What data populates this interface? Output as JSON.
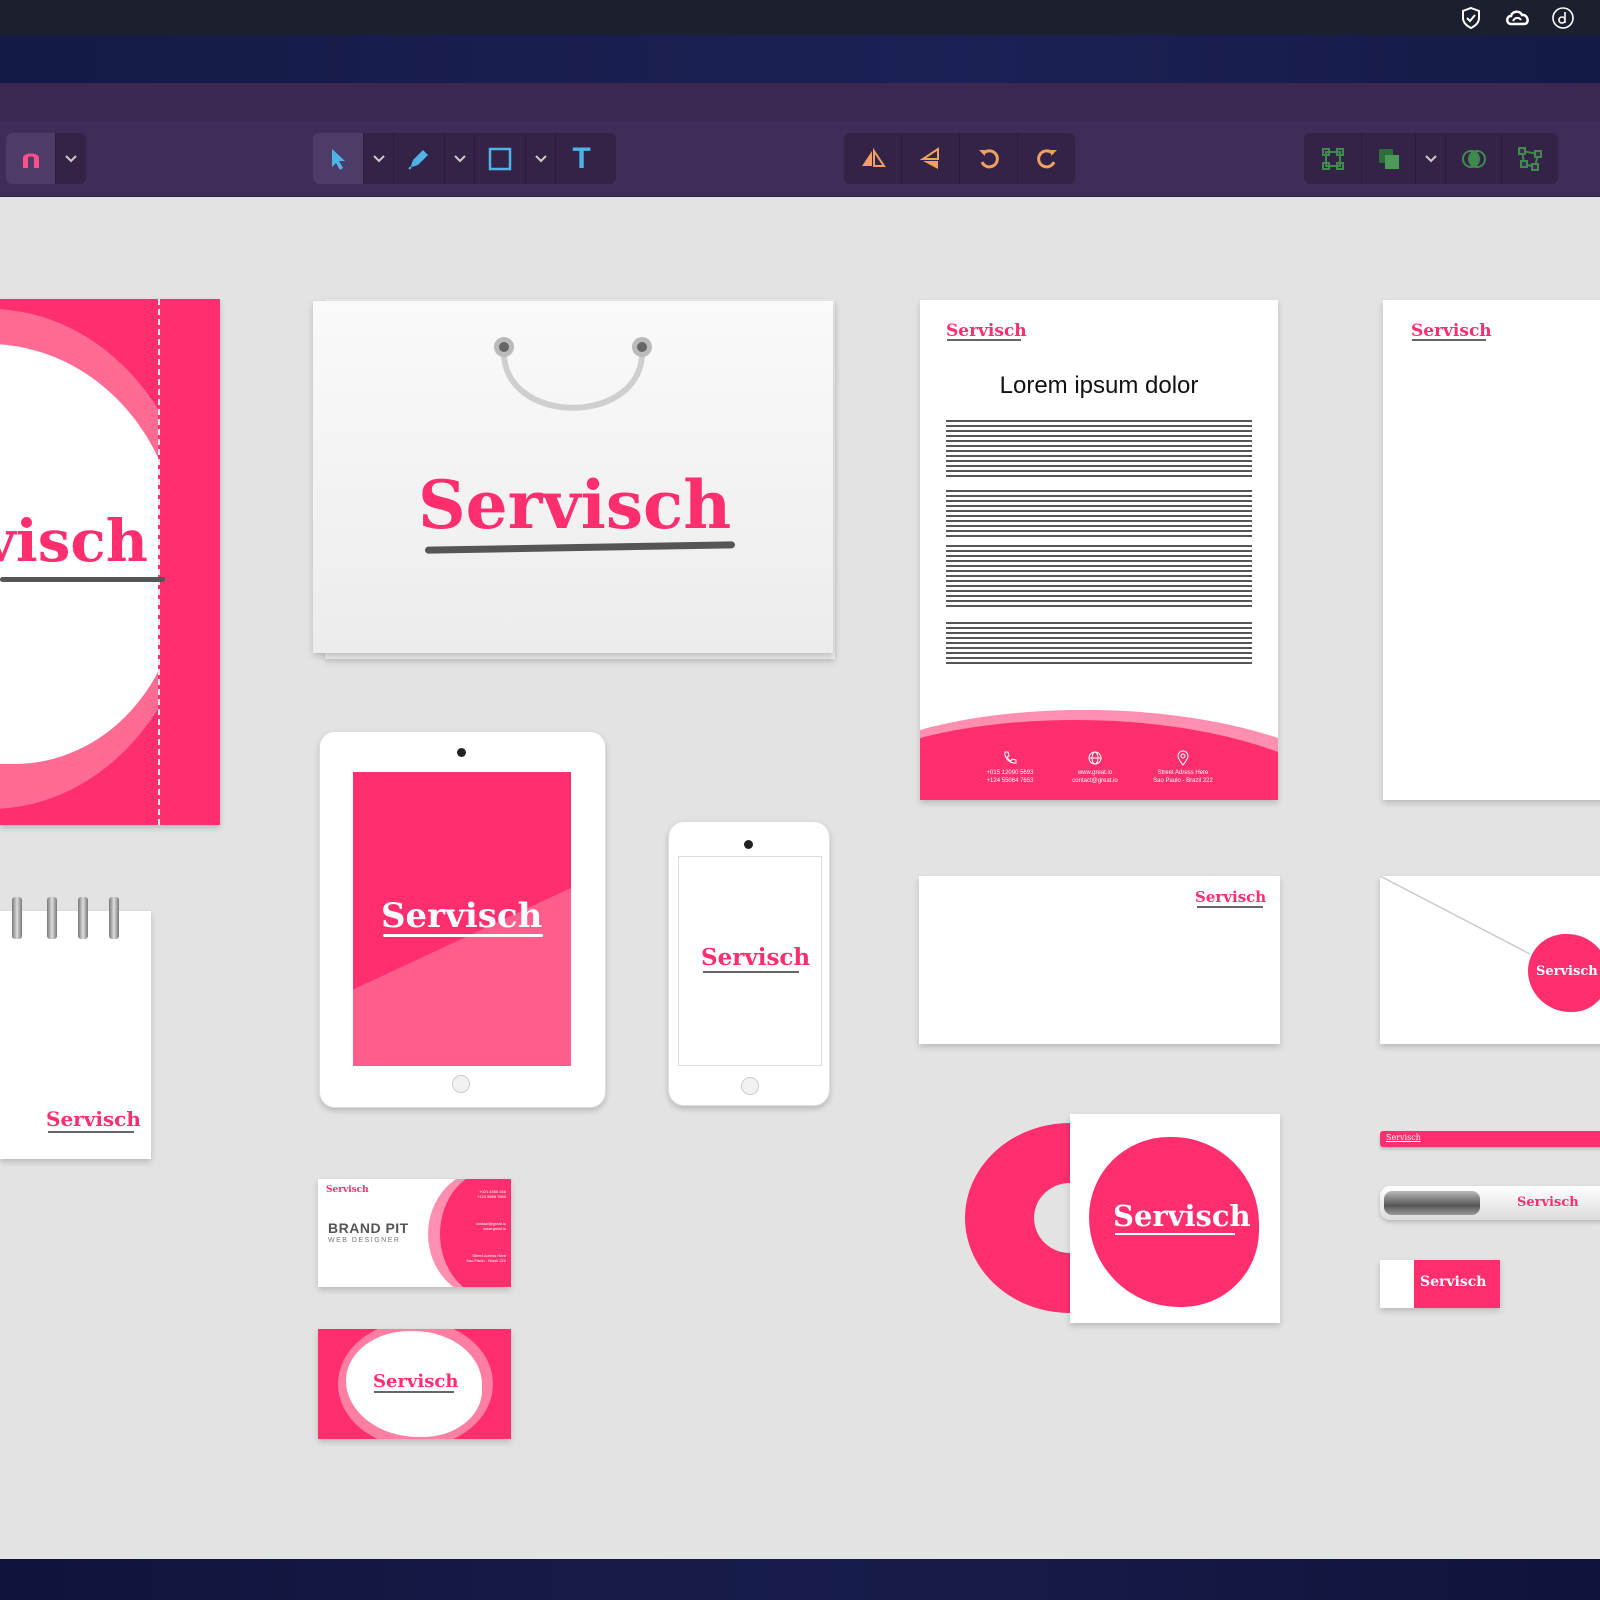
{
  "toolbar": {
    "groups": [
      {
        "name": "snapping",
        "tools": [
          "magnet-icon"
        ]
      },
      {
        "name": "draw-tools",
        "tools": [
          "pointer-icon",
          "pen-icon",
          "rectangle-icon",
          "text-icon"
        ]
      },
      {
        "name": "transform",
        "tools": [
          "flip-horizontal-icon",
          "flip-vertical-icon",
          "rotate-left-icon",
          "rotate-right-icon"
        ]
      },
      {
        "name": "arrange",
        "tools": [
          "transform-box-icon",
          "layers-icon",
          "boolean-icon",
          "node-icon"
        ]
      }
    ],
    "text_tool_glyph": "T",
    "colors": {
      "accent": "#4fb3e8",
      "magnet": "#ff4f8a",
      "arrange": "#3f8a4c",
      "transform": "#f0a060"
    }
  },
  "system_icons": [
    "check-shield-icon",
    "creative-cloud-icon",
    "d-icon"
  ],
  "mockup": {
    "brand": "Servisch",
    "brand_color": "#ff2e6e",
    "letterhead": {
      "title": "Lorem ipsum dolor",
      "contacts": [
        {
          "icon": "phone-icon",
          "line1": "+015 12090 5693",
          "line2": "+124 55064 7653"
        },
        {
          "icon": "globe-icon",
          "line1": "www.great.io",
          "line2": "contact@great.io"
        },
        {
          "icon": "pin-icon",
          "line1": "Street Adress Here",
          "line2": "Sao Paulo - Brazil 222"
        }
      ]
    },
    "business_card": {
      "name": "BRAND PIT",
      "role": "WEB DESIGNER",
      "contacts": [
        "+021 4566 456",
        "+124 5566 7653",
        "contact@great.io",
        "www.great.io",
        "Street Adress Here",
        "Sao Paulo - Brazil 222"
      ]
    },
    "folder_logo_fragment": "visch",
    "pencil_brand": "Servisch"
  }
}
